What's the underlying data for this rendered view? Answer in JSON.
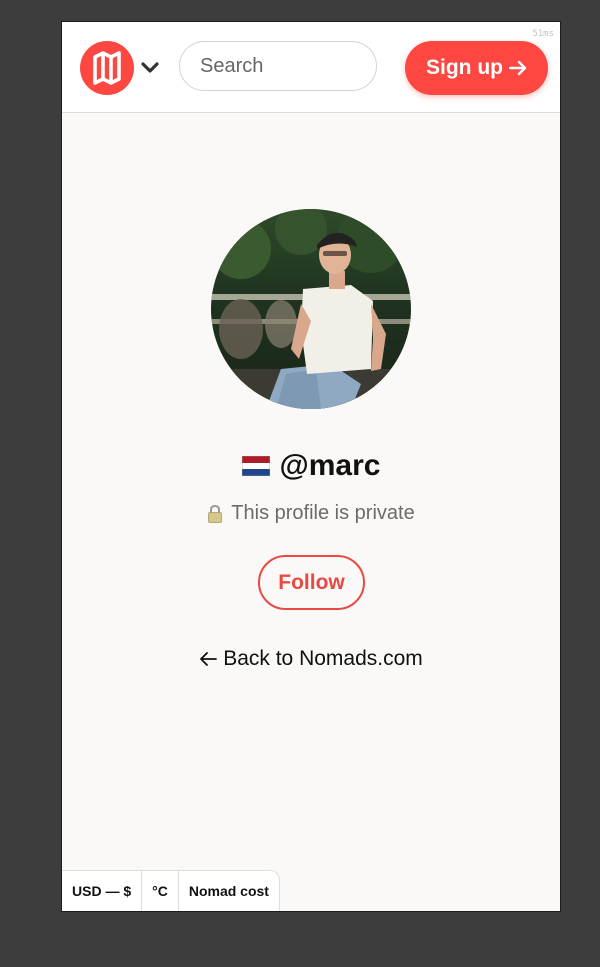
{
  "header": {
    "timing": "51ms",
    "logo_icon": "nomads-map-logo-icon",
    "menu_icon": "chevron-down-icon",
    "search_placeholder": "Search",
    "signup_label": "Sign up",
    "signup_icon": "arrow-right-icon"
  },
  "profile": {
    "avatar_icon": "profile-photo",
    "flag_icon": "netherlands-flag-icon",
    "username": "@marc",
    "lock_icon": "lock-icon",
    "private_text": "This profile is private",
    "follow_label": "Follow",
    "back_icon": "arrow-left-icon",
    "back_label": "Back to Nomads.com"
  },
  "footer": {
    "items": [
      {
        "label": "USD — $"
      },
      {
        "label": "°C"
      },
      {
        "label": "Nomad cost"
      }
    ]
  },
  "colors": {
    "brand": "#ff4742",
    "page_bg": "#faf9f7",
    "outer_bg": "#3d3d3d",
    "follow_border": "#e84a43"
  }
}
